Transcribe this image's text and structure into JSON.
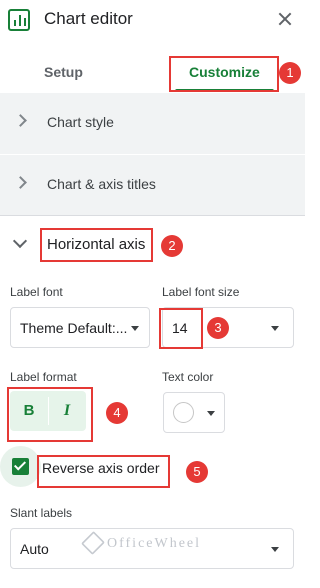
{
  "header": {
    "title": "Chart editor",
    "app_icon": "chart-icon",
    "close_icon": "close-icon"
  },
  "tabs": [
    {
      "label": "Setup"
    },
    {
      "label": "Customize",
      "active": true
    }
  ],
  "sections": {
    "chart_style": "Chart style",
    "chart_axis_titles": "Chart & axis titles",
    "horizontal_axis": "Horizontal axis"
  },
  "fields": {
    "label_font": {
      "label": "Label font",
      "value": "Theme Default:..."
    },
    "label_font_size": {
      "label": "Label font size",
      "value": "14"
    },
    "label_format": {
      "label": "Label format",
      "bold": "B",
      "italic": "I"
    },
    "text_color": {
      "label": "Text color",
      "value": "#ffffff"
    },
    "reverse_axis": {
      "label": "Reverse axis order",
      "checked": true
    },
    "slant_labels": {
      "label": "Slant labels",
      "value": "Auto"
    }
  },
  "annotations": [
    "1",
    "2",
    "3",
    "4",
    "5"
  ],
  "watermark": "OfficeWheel",
  "colors": {
    "accent": "#188038",
    "annotation": "#e53935",
    "panel": "#f1f3f4"
  }
}
